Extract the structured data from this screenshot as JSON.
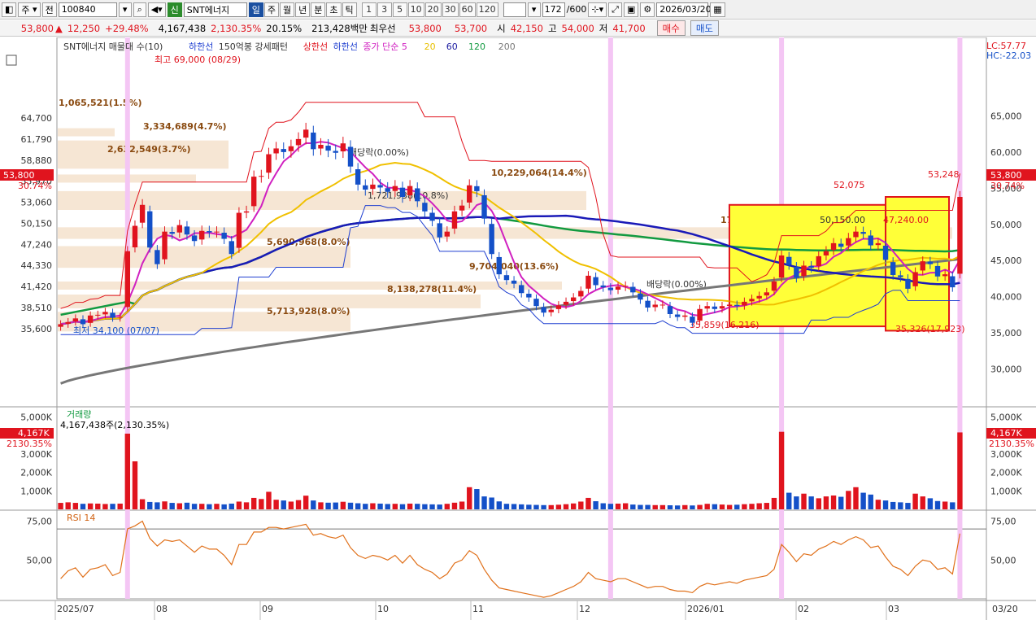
{
  "toolbar": {
    "type_select": "주",
    "view_select": "전",
    "code": "100840",
    "badge": "신",
    "stock_name": "SNT에너지",
    "periods": [
      "일",
      "주",
      "월",
      "년",
      "분",
      "초",
      "틱"
    ],
    "active_period": "일",
    "intervals": [
      "1",
      "3",
      "5",
      "10",
      "20",
      "30",
      "60",
      "120"
    ],
    "count": "172",
    "total": "/600",
    "date": "2026/03/20"
  },
  "quote": {
    "price": "53,800",
    "change": "12,250",
    "change_pct": "+29.48%",
    "volume": "4,167,438",
    "volume_pct": "2,130.35%",
    "turnover": "20.15%",
    "amount": "213,428백만",
    "ask_label": "최우선",
    "ask": "53,800",
    "bid": "53,700",
    "open_label": "시",
    "open": "42,150",
    "high_label": "고",
    "high": "54,000",
    "low_label": "저",
    "low": "41,700",
    "buy": "매수",
    "sell": "매도"
  },
  "legend": {
    "main_title": "SNT에너지 매물대 수(10)",
    "items": [
      {
        "text": "하한선",
        "color": "#1f3fd0"
      },
      {
        "text": "150억봉 강세패턴",
        "color": "#333333"
      },
      {
        "text": "상한선",
        "color": "#e0141e"
      },
      {
        "text": "하한선",
        "color": "#1f3fd0"
      },
      {
        "text": "종가 단순 5",
        "color": "#d020c0"
      },
      {
        "text": "20",
        "color": "#e8c000"
      },
      {
        "text": "60",
        "color": "#1a1aa0"
      },
      {
        "text": "120",
        "color": "#129a40"
      },
      {
        "text": "200",
        "color": "#777777"
      }
    ],
    "lc": "LC:57.77",
    "hc": "HC:-22.03"
  },
  "annotations": {
    "high_mark": "최고 69,000 (08/29)",
    "low_mark": "최저 34,100 (07/07)",
    "vp_labels": [
      "1,065,521(1.5%)",
      "3,334,689(4.7%)",
      "2,632,549(3.7%)",
      "10,229,064(14.4%)",
      "17,020,409(23.9%)",
      "5,690,968(8.0%)",
      "9,704,040(13.6%)",
      "8,138,278(11.4%)",
      "5,713,928(8.0%)"
    ],
    "misc": [
      "1,721,938(10.8%)",
      "50,150.00",
      "47,240.00",
      "52,075",
      "53,248",
      "35,859(16,216)",
      "35,326(17,923)",
      "배당락(0.00%)",
      "배당락(0.00%)"
    ],
    "cur_price_tag": "53,800",
    "cur_pct_tag": "30.74%"
  },
  "volume_panel": {
    "title": "거래량",
    "value_text": "4,167,438주(2,130.35%)",
    "cur_tag": "4,167K",
    "cur_pct": "2130.35%"
  },
  "rsi_panel": {
    "title": "RSI 14"
  },
  "x_labels": [
    "2025/07",
    "08",
    "09",
    "10",
    "11",
    "12",
    "2026/01",
    "02",
    "03",
    "03/20"
  ],
  "colors": {
    "up": "#e0141e",
    "down": "#1450c8",
    "ma5": "#d020c0",
    "ma20": "#f0c000",
    "ma60": "#1a1ab8",
    "ma120": "#129a40",
    "ma200": "#777777"
  },
  "chart_data": [
    {
      "type": "line",
      "title": "SNT에너지 일봉 (캔들)",
      "ylim": [
        25000,
        70000
      ],
      "y_ticks": [
        "64,700",
        "61,790",
        "58,880",
        "55,970",
        "53,060",
        "50,150",
        "47,240",
        "44,330",
        "41,420",
        "38,510",
        "35,600"
      ],
      "right_ticks": [
        "65,000",
        "60,000",
        "55,000",
        "50,000",
        "45,000",
        "40,000",
        "35,000",
        "30,000"
      ],
      "series": [
        {
          "name": "종가",
          "values": [
            36200,
            36500,
            37000,
            36200,
            37400,
            37500,
            37900,
            37100,
            37200,
            46300,
            49800,
            52700,
            46800,
            44500,
            49000,
            48700,
            49900,
            48600,
            47700,
            49100,
            48900,
            49000,
            48000,
            45900,
            51600,
            51800,
            56600,
            56700,
            59700,
            60500,
            60000,
            60800,
            61800,
            63100,
            60400,
            61000,
            60200,
            59900,
            61200,
            58000,
            55500,
            54800,
            55500,
            55100,
            54500,
            55300,
            53800,
            55300,
            53200,
            51800,
            50500,
            48200,
            49000,
            51800,
            52600,
            55400,
            54600,
            50800,
            45900,
            43100,
            42300,
            41800,
            40500,
            39900,
            38700,
            37800,
            38200,
            38800,
            39300,
            39900,
            40800,
            42900,
            41600,
            41300,
            40900,
            41400,
            41500,
            40600,
            39600,
            38500,
            38900,
            38900,
            37600,
            37200,
            37400,
            36400,
            38300,
            38700,
            38300,
            38700,
            38900,
            38700,
            39300,
            39700,
            40100,
            40600,
            42100,
            45700,
            44400,
            42600,
            44300,
            44000,
            45600,
            46300,
            47400,
            46900,
            48100,
            49000,
            48700,
            47100,
            47400,
            45100,
            43000,
            42700,
            41100,
            43400,
            44900,
            44500,
            42800,
            43100,
            41300,
            53800
          ]
        }
      ]
    },
    {
      "type": "bar",
      "title": "거래량",
      "ylim": [
        0,
        5200
      ],
      "y_ticks": [
        "5,000K",
        "4,000K",
        "3,000K",
        "2,000K",
        "1,000K"
      ],
      "series": [
        {
          "name": "거래량",
          "values": [
            350,
            380,
            350,
            300,
            320,
            310,
            290,
            300,
            310,
            4100,
            2600,
            550,
            400,
            380,
            430,
            350,
            330,
            360,
            300,
            300,
            280,
            300,
            270,
            310,
            420,
            380,
            620,
            560,
            950,
            520,
            480,
            420,
            500,
            740,
            480,
            380,
            360,
            370,
            410,
            360,
            330,
            300,
            330,
            310,
            290,
            300,
            280,
            310,
            300,
            280,
            270,
            260,
            300,
            360,
            420,
            1200,
            1100,
            700,
            640,
            430,
            300,
            290,
            270,
            250,
            240,
            230,
            230,
            250,
            280,
            320,
            420,
            620,
            440,
            330,
            300,
            310,
            330,
            260,
            240,
            240,
            230,
            230,
            220,
            210,
            230,
            210,
            240,
            300,
            280,
            260,
            240,
            250,
            280,
            300,
            330,
            350,
            620,
            4200,
            900,
            700,
            850,
            700,
            600,
            700,
            750,
            680,
            1000,
            1200,
            900,
            800,
            520,
            480,
            400,
            380,
            350,
            850,
            700,
            600,
            450,
            420,
            380,
            4167
          ]
        }
      ]
    },
    {
      "type": "line",
      "title": "RSI 14",
      "ylim": [
        25,
        80
      ],
      "y_ticks": [
        "75,00",
        "50,00"
      ],
      "series": [
        {
          "name": "RSI 14",
          "values": [
            38,
            43,
            45,
            39,
            44,
            45,
            47,
            40,
            42,
            70,
            72,
            75,
            64,
            59,
            63,
            62,
            63,
            59,
            55,
            59,
            57,
            57,
            53,
            47,
            60,
            60,
            68,
            68,
            71,
            71,
            70,
            71,
            72,
            73,
            66,
            67,
            65,
            64,
            66,
            58,
            53,
            51,
            53,
            52,
            50,
            53,
            48,
            53,
            47,
            44,
            42,
            38,
            41,
            48,
            50,
            56,
            53,
            44,
            37,
            32,
            31,
            30,
            29,
            28,
            27,
            26,
            27,
            29,
            31,
            33,
            36,
            42,
            38,
            37,
            36,
            38,
            38,
            36,
            34,
            32,
            33,
            33,
            31,
            30,
            30,
            29,
            33,
            35,
            34,
            35,
            36,
            35,
            37,
            38,
            39,
            40,
            44,
            60,
            55,
            49,
            54,
            53,
            57,
            59,
            62,
            60,
            63,
            65,
            63,
            58,
            59,
            52,
            46,
            44,
            40,
            46,
            50,
            49,
            44,
            45,
            41,
            67
          ]
        }
      ]
    }
  ]
}
